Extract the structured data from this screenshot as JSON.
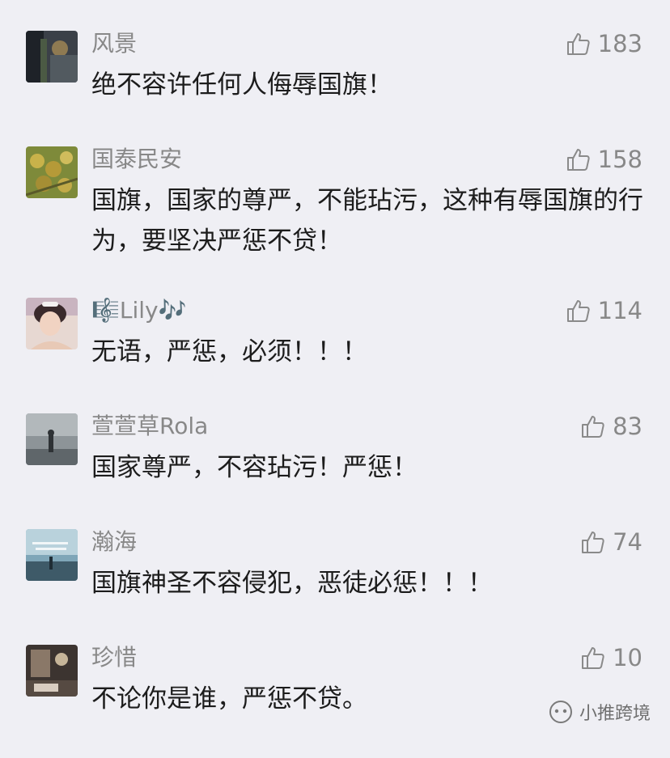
{
  "comments": [
    {
      "name": "风景",
      "likes": "183",
      "text": "绝不容许任何人侮辱国旗！"
    },
    {
      "name": "国泰民安",
      "likes": "158",
      "text": "国旗，国家的尊严，不能玷污，这种有辱国旗的行为，要坚决严惩不贷！"
    },
    {
      "name": "🎼Lily🎶",
      "likes": "114",
      "text": "无语，严惩，必须！！！"
    },
    {
      "name": "萱萱草Rola",
      "likes": "83",
      "text": "国家尊严，不容玷污！严惩！"
    },
    {
      "name": "瀚海",
      "likes": "74",
      "text": "国旗神圣不容侵犯，恶徒必惩！！！"
    },
    {
      "name": "珍惜",
      "likes": "10",
      "text": "不论你是谁，严惩不贷。"
    }
  ],
  "icons": {
    "like": "thumbs-up-icon",
    "watermark": "wechat-channel-icon"
  },
  "colors": {
    "background": "#efeff4",
    "meta": "#888888",
    "text": "#1c1c1c"
  },
  "watermark": {
    "label": "小推跨境"
  }
}
